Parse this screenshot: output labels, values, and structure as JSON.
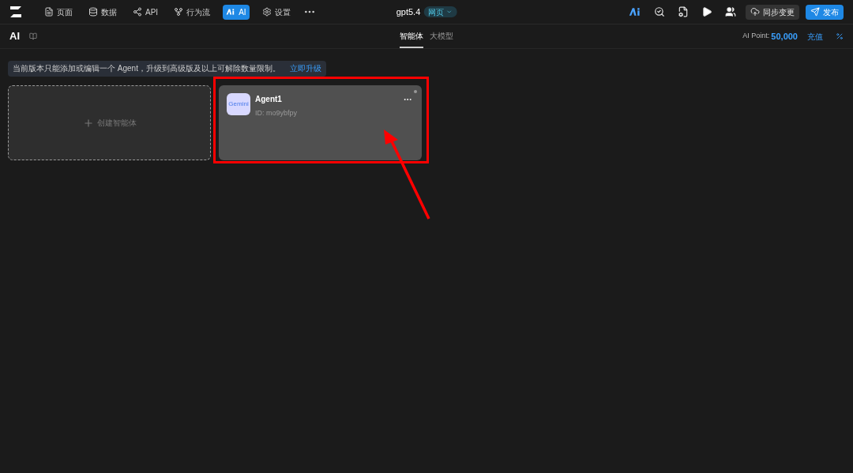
{
  "nav": [
    {
      "label": "页面",
      "selected": false
    },
    {
      "label": "数据",
      "selected": false
    },
    {
      "label": "API",
      "selected": false
    },
    {
      "label": "行为流",
      "selected": false
    },
    {
      "label": "AI",
      "selected": true
    },
    {
      "label": "设置",
      "selected": false
    }
  ],
  "project": {
    "name": "gpt5.4",
    "badge": "网页"
  },
  "sync_button": "同步变更",
  "publish_button": "发布",
  "page_title": "AI",
  "tabs": [
    {
      "label": "智能体",
      "selected": true
    },
    {
      "label": "大模型",
      "selected": false
    }
  ],
  "points": {
    "label": "AI Point:",
    "value": "50,000",
    "recharge": "充值"
  },
  "notice": {
    "text": "当前版本只能添加或编辑一个 Agent，升级到高级版及以上可解除数量限制。",
    "link": "立即升级"
  },
  "create_card": "创建智能体",
  "agents": [
    {
      "name": "Agent1",
      "id": "ID: mo9ybfpy",
      "logo_text": "Gemini"
    }
  ]
}
